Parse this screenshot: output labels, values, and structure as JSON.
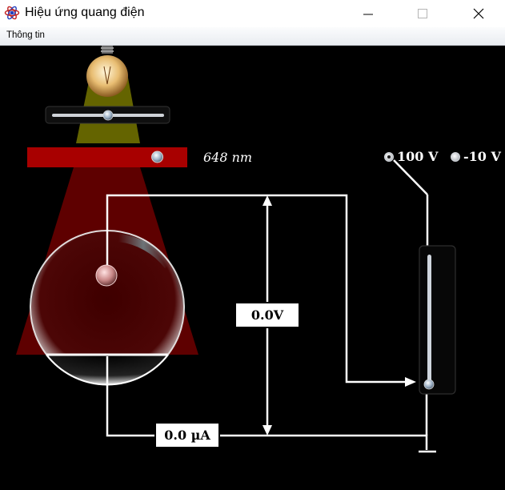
{
  "window": {
    "title": "Hiệu ứng quang điện",
    "icon": "atom-icon",
    "controls": [
      "minimize-icon",
      "maximize-icon",
      "close-icon"
    ]
  },
  "menu": {
    "items": [
      "Thông tin"
    ]
  },
  "simulation": {
    "intensity_slider_fraction": 0.5,
    "wavelength_slider_fraction": 0.92,
    "wavelength_label": "648 nm",
    "light_color": "#a80000",
    "voltage_options": [
      {
        "label": "100 V",
        "selected": true
      },
      {
        "label": "-10 V",
        "selected": false
      }
    ],
    "rheostat_fraction": 0.0,
    "voltage_reading": "0.0V",
    "current_reading": "0.0 µA"
  }
}
